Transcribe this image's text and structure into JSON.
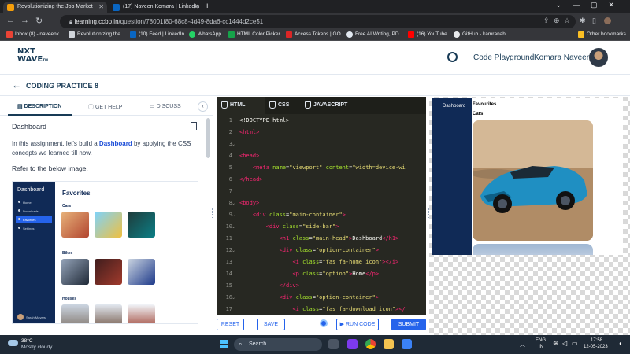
{
  "browser": {
    "tabs": [
      {
        "title": "Revolutionizing the Job Market |",
        "active": true
      },
      {
        "title": "(17) Naveen Komara | LinkedIn",
        "active": false
      }
    ],
    "url_host": "learning.ccbp.in",
    "url_path": "/question/78001f80-68c8-4d49-8da6-cc1444d2ce51",
    "bookmarks": [
      "Inbox (8) - naveenk...",
      "Revolutionizing the...",
      "(10) Feed | LinkedIn",
      "WhatsApp",
      "HTML Color Picker",
      "Access Tokens | GO...",
      "Free AI Writing, PD...",
      "(16) YouTube",
      "GitHub - kamranah..."
    ],
    "other_bookmarks": "Other bookmarks"
  },
  "app": {
    "logo_line1": "NXT",
    "logo_line2": "WAVE",
    "logo_tm": "TM",
    "playground": "Code Playground",
    "username": "Komara Naveen",
    "page_title": "CODING PRACTICE 8"
  },
  "left_panel": {
    "tabs": [
      "DESCRIPTION",
      "GET HELP",
      "DISCUSS"
    ],
    "task_title": "Dashboard",
    "desc_before": "In this assignment, let's build a ",
    "desc_highlight": "Dashboard",
    "desc_after": " by applying the CSS concepts we learned till now.",
    "refer": "Refer to the below image.",
    "preview": {
      "logo": "Dashboard",
      "menu": [
        "Home",
        "Downloads",
        "Favorites",
        "Settings"
      ],
      "active_menu": 2,
      "user": "Sarah Mayers",
      "heading": "Favorites",
      "categories": [
        "Cars",
        "Bikes",
        "Houses"
      ]
    }
  },
  "editor": {
    "tabs": [
      "HTML",
      "CSS",
      "JAVASCRIPT"
    ],
    "active_tab": 0,
    "line_numbers": [
      "1",
      "2",
      "3",
      "4",
      "5",
      "6",
      "7",
      "8",
      "9",
      "10",
      "11",
      "12",
      "13",
      "14",
      "15",
      "16",
      "17"
    ],
    "buttons": {
      "reset": "RESET",
      "save": "SAVE",
      "run": "▶ RUN CODE",
      "submit": "SUBMIT"
    }
  },
  "output": {
    "sidebar_title": "Dashboard",
    "heading": "Favourites",
    "category": "Cars"
  },
  "taskbar": {
    "temp": "38°C",
    "condition": "Mostly cloudy",
    "search": "Search",
    "lang1": "ENG",
    "lang2": "IN",
    "time": "17:58",
    "date": "12-05-2023"
  }
}
